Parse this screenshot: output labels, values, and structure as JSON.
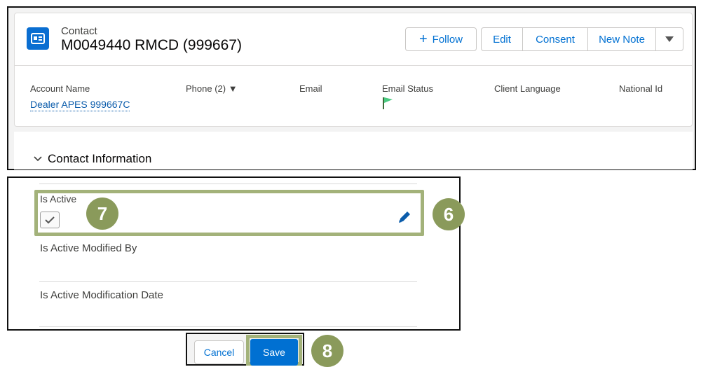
{
  "header": {
    "object_label": "Contact",
    "record_title": "M0049440 RMCD (999667)",
    "buttons": {
      "follow": "Follow",
      "edit": "Edit",
      "consent": "Consent",
      "new_note": "New Note"
    }
  },
  "highlights": {
    "fields": [
      {
        "label": "Account Name",
        "value": "Dealer APES 999667C"
      },
      {
        "label": "Phone (2) ▼"
      },
      {
        "label": "Email"
      },
      {
        "label": "Email Status",
        "icon": "green-flag-icon"
      },
      {
        "label": "Client Language"
      },
      {
        "label": "National Id"
      }
    ]
  },
  "section": {
    "title": "Contact Information"
  },
  "detail": {
    "is_active_label": "Is Active",
    "is_active_checked": true,
    "modified_by_label": "Is Active Modified By",
    "modification_date_label": "Is Active Modification Date"
  },
  "footer": {
    "cancel": "Cancel",
    "save": "Save"
  },
  "callouts": {
    "c6": "6",
    "c7": "7",
    "c8": "8"
  },
  "colors": {
    "brand_blue": "#0070d2",
    "link_blue": "#0b5cab",
    "callout_green": "#8a9a5b",
    "highlight_green": "#a3b27a",
    "flag_green": "#4bca81"
  }
}
